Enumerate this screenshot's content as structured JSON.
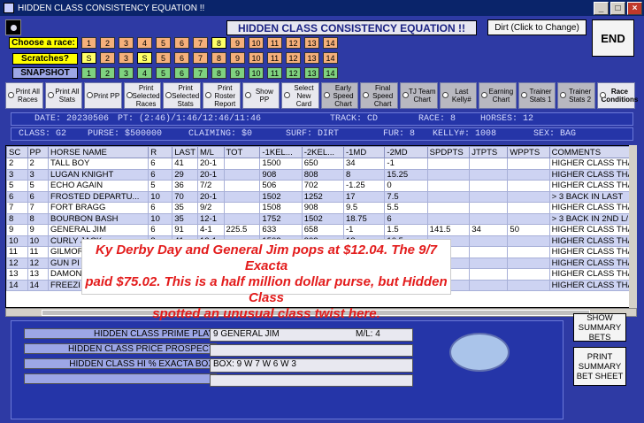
{
  "window": {
    "title": "HIDDEN CLASS CONSISTENCY EQUATION !!",
    "btn_min": "_",
    "btn_max": "□",
    "btn_close": "×"
  },
  "header": {
    "title": "HIDDEN CLASS CONSISTENCY EQUATION !!",
    "surface_button": "Dirt (Click to Change)",
    "end_button": "END"
  },
  "rows": {
    "race_label": "Choose  a race:",
    "scratch_label": "Scratches?",
    "snapshot_label": "SNAPSHOT"
  },
  "race_buttons": [
    "1",
    "2",
    "3",
    "4",
    "5",
    "6",
    "7",
    "8",
    "9",
    "10",
    "11",
    "12",
    "13",
    "14"
  ],
  "scratch_buttons": [
    "S",
    "2",
    "3",
    "S",
    "5",
    "6",
    "7",
    "8",
    "9",
    "10",
    "11",
    "12",
    "13",
    "14"
  ],
  "snapshot_buttons": [
    "1",
    "2",
    "3",
    "4",
    "5",
    "6",
    "7",
    "8",
    "9",
    "10",
    "11",
    "12",
    "13",
    "14"
  ],
  "options": [
    {
      "label": "Print All Races"
    },
    {
      "label": "Print All Stats"
    },
    {
      "label": "Print PP"
    },
    {
      "label": "Print Selected Races"
    },
    {
      "label": "Print Selected Stats"
    },
    {
      "label": "Print Roster Report"
    },
    {
      "label": "Show PP"
    },
    {
      "label": "Select New Card"
    },
    {
      "label": "Early Speed Chart"
    },
    {
      "label": "Final Speed Chart"
    },
    {
      "label": "TJ Team Chart"
    },
    {
      "label": "Last Kelly#"
    },
    {
      "label": "Earning Chart"
    },
    {
      "label": "Trainer Stats 1"
    },
    {
      "label": "Trainer Stats 2"
    },
    {
      "label": "Race Conditions"
    }
  ],
  "info": {
    "date": "DATE: 20230506",
    "pt": "PT: (2:46)/1:46/12:46/11:46",
    "track": "TRACK: CD",
    "race": "RACE: 8",
    "horses": "HORSES: 12",
    "class": "CLASS: G2",
    "purse": "PURSE: $500000",
    "claiming": "CLAIMING: $0",
    "surf": "SURF: DIRT",
    "fur": "FUR: 8",
    "kelly": "KELLY#: 1008",
    "sex": "SEX: BAG"
  },
  "table": {
    "headers": [
      "SC",
      "PP",
      "HORSE NAME",
      "R",
      "LAST",
      "M/L",
      "TOT",
      "-1KEL...",
      "-2KEL...",
      "-1MD",
      "-2MD",
      "SPDPTS",
      "JTPTS",
      "WPPTS",
      "COMMENTS"
    ],
    "rows": [
      [
        "2",
        "2",
        "TALL BOY",
        "6",
        "41",
        "20-1",
        "",
        "1500",
        "650",
        "34",
        "-1",
        "",
        "",
        "",
        "HIGHER CLASS THA"
      ],
      [
        "3",
        "3",
        "LUGAN KNIGHT",
        "6",
        "29",
        "20-1",
        "",
        "908",
        "808",
        "8",
        "15.25",
        "",
        "",
        "",
        "HIGHER CLASS THA"
      ],
      [
        "5",
        "5",
        "ECHO AGAIN",
        "5",
        "36",
        "7/2",
        "",
        "506",
        "702",
        "-1.25",
        "0",
        "",
        "",
        "",
        "HIGHER CLASS THA"
      ],
      [
        "6",
        "6",
        "FROSTED DEPARTU...",
        "10",
        "70",
        "20-1",
        "",
        "1502",
        "1252",
        "17",
        "7.5",
        "",
        "",
        "",
        "> 3 BACK IN LAST"
      ],
      [
        "7",
        "7",
        "FORT BRAGG",
        "6",
        "35",
        "9/2",
        "",
        "1508",
        "908",
        "9.5",
        "5.5",
        "",
        "",
        "",
        "HIGHER CLASS THA"
      ],
      [
        "8",
        "8",
        "BOURBON BASH",
        "10",
        "35",
        "12-1",
        "",
        "1752",
        "1502",
        "18.75",
        "6",
        "",
        "",
        "",
        "> 3 BACK IN 2ND L/"
      ],
      [
        "9",
        "9",
        "GENERAL JIM",
        "6",
        "91",
        "4-1",
        "225.5",
        "633",
        "658",
        "-1",
        "1.5",
        "141.5",
        "34",
        "50",
        "HIGHER CLASS THA"
      ],
      [
        "10",
        "10",
        "CURLY JACK",
        "8",
        "41",
        "12-1",
        "",
        "1502",
        "902",
        "12",
        "10.5",
        "",
        "",
        "",
        "HIGHER CLASS THA"
      ],
      [
        "11",
        "11",
        "GILMOR",
        "",
        "",
        "",
        "",
        "",
        "",
        "",
        "",
        "",
        "",
        "",
        "HIGHER CLASS THA"
      ],
      [
        "12",
        "12",
        "GUN PI",
        "",
        "",
        "",
        "",
        "",
        "",
        "",
        "",
        "",
        "",
        "",
        "HIGHER CLASS THA"
      ],
      [
        "13",
        "13",
        "DAMON",
        "",
        "",
        "",
        "",
        "",
        "",
        "",
        "",
        "",
        "",
        "",
        "HIGHER CLASS THA"
      ],
      [
        "14",
        "14",
        "FREEZI",
        "",
        "",
        "",
        "",
        "",
        "",
        "",
        "",
        "",
        "",
        "",
        "HIGHER CLASS THA"
      ]
    ]
  },
  "overlay": {
    "line1": "Ky Derby Day and General Jim pops at $12.04.  The 9/7 Exacta",
    "line2": "paid $75.02.  This is a half million dollar purse, but Hidden Class",
    "line3": "spotted an unusual class twist here."
  },
  "lower": {
    "prime_label": "HIDDEN CLASS PRIME PLAY",
    "prime_value": "9  GENERAL JIM",
    "ml_label": "M/L:  4",
    "prospect_label": "HIDDEN CLASS PRICE PROSPECT",
    "exacta_label": "HIDDEN CLASS HI % EXACTA BOX",
    "box_value": "BOX: 9  W 7  W 6  W 3",
    "summary_bets": "SHOW SUMMARY BETS",
    "print_sheet": "PRINT SUMMARY BET SHEET"
  }
}
